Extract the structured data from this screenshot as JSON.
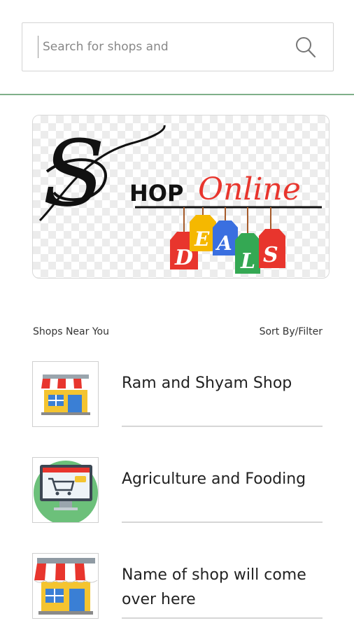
{
  "search": {
    "placeholder": "Search for shops and",
    "icon": "search-icon"
  },
  "banner": {
    "logo_text_s": "S",
    "logo_text_hop": "HOP",
    "logo_text_online": "Online",
    "tags": [
      "D",
      "E",
      "A",
      "L",
      "S"
    ],
    "tag_colors": [
      "#e8352d",
      "#f5b800",
      "#3a6fe0",
      "#34a853",
      "#e8352d"
    ]
  },
  "section": {
    "title": "Shops Near You",
    "sort_filter": "Sort By/Filter"
  },
  "shops": [
    {
      "name": "Ram and Shyam Shop",
      "icon": "storefront-icon"
    },
    {
      "name": "Agriculture and Fooding",
      "icon": "online-cart-icon"
    },
    {
      "name": "Name of shop will come over here",
      "icon": "storefront-icon"
    }
  ],
  "colors": {
    "divider": "#7fb08a",
    "accent_red": "#e8352d"
  }
}
